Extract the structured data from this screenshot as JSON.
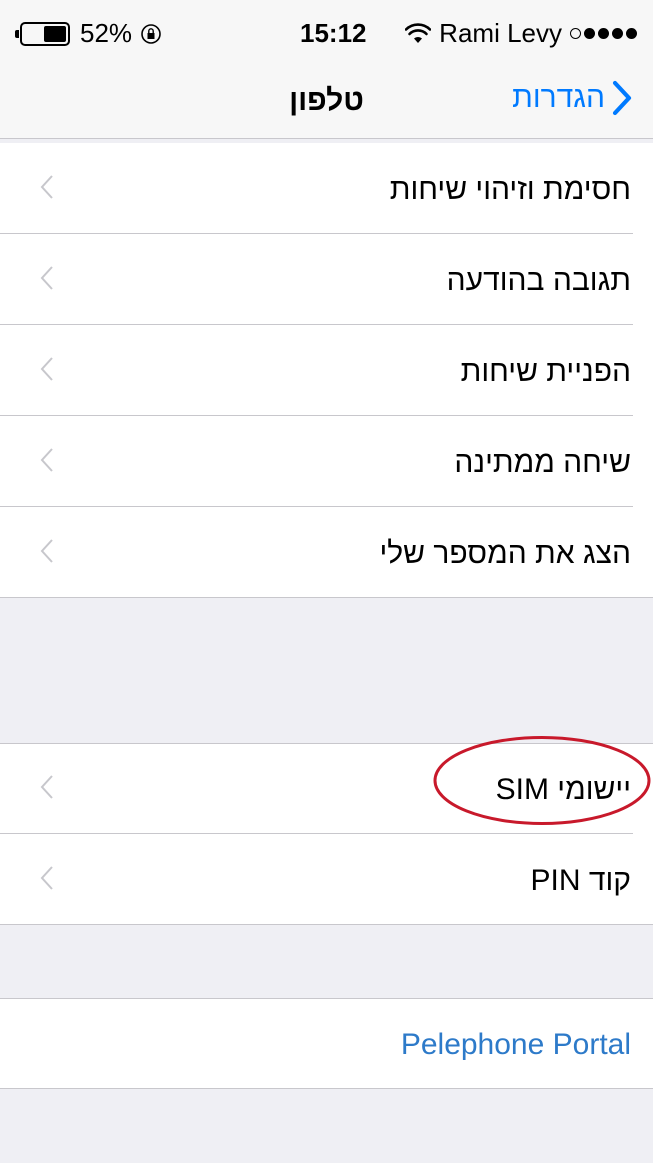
{
  "status_bar": {
    "battery_percent": "52%",
    "battery_level": 0.52,
    "time": "15:12",
    "carrier": "Rami Levy",
    "signal_bars_filled": 4,
    "signal_bars_total": 5,
    "icons": [
      "battery-icon",
      "orientation-lock-icon",
      "wifi-icon",
      "signal-icon"
    ]
  },
  "nav": {
    "title": "טלפון",
    "back_label": "הגדרות",
    "back_icon": "chevron-right-icon",
    "accent_color": "#007aff"
  },
  "section1": {
    "items": [
      {
        "label": "חסימת וזיהוי שיחות"
      },
      {
        "label": "תגובה בהודעה"
      },
      {
        "label": "הפניית שיחות"
      },
      {
        "label": "שיחה ממתינה"
      },
      {
        "label": "הצג את המספר שלי"
      }
    ]
  },
  "section2": {
    "items": [
      {
        "label": "יישומי SIM"
      },
      {
        "label": "קוד PIN"
      }
    ]
  },
  "section3": {
    "items": [
      {
        "label": "Pelephone Portal"
      }
    ]
  },
  "annotation": {
    "highlight_color": "#c8192b",
    "highlighted_item": "יישומי SIM"
  }
}
